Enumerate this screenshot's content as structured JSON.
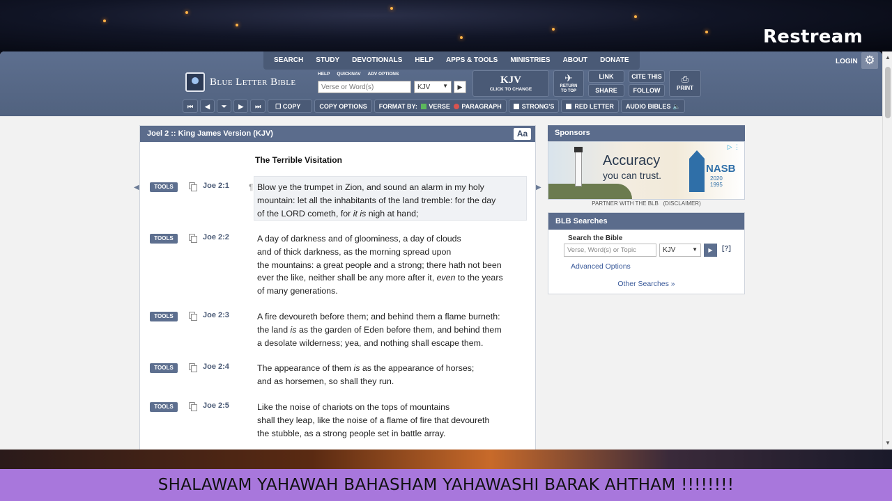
{
  "overlay": {
    "brand": "Restream",
    "banner_text": "SHALAWAM YAHAWAH BAHASHAM YAHAWASHI BARAK AHTHAM !!!!!!!!"
  },
  "header": {
    "nav": [
      "SEARCH",
      "STUDY",
      "DEVOTIONALS",
      "HELP",
      "APPS & TOOLS",
      "MINISTRIES",
      "ABOUT",
      "DONATE"
    ],
    "login": "LOGIN",
    "logo": "Blue Letter Bible",
    "mini_links": [
      "HELP",
      "QUICKNAV",
      "ADV OPTIONS"
    ],
    "search_placeholder": "Verse or Word(s)",
    "version": "KJV",
    "kjv_big": "KJV",
    "kjv_small": "CLICK TO CHANGE",
    "return_top": [
      "RETURN",
      "TO TOP"
    ],
    "link": "LINK",
    "share": "SHARE",
    "cite": "CITE THIS",
    "follow": "FOLLOW",
    "print": "PRINT"
  },
  "toolbar": {
    "copy": "COPY",
    "copy_options": "COPY OPTIONS",
    "format_by": "FORMAT BY:",
    "verse": "VERSE",
    "paragraph": "PARAGRAPH",
    "strongs": "STRONG'S",
    "red_letter": "RED LETTER",
    "audio": "AUDIO BIBLES"
  },
  "main": {
    "title": "Joel 2 :: King James Version (KJV)",
    "aa": "Aa",
    "section_title": "The Terrible Visitation",
    "tools_label": "TOOLS",
    "verses": [
      {
        "ref": "Joe 2:1"
      },
      {
        "ref": "Joe 2:2"
      },
      {
        "ref": "Joe 2:3"
      },
      {
        "ref": "Joe 2:4"
      },
      {
        "ref": "Joe 2:5"
      }
    ],
    "v1": {
      "l1": "Blow ye the trumpet in Zion, and sound an alarm in my holy",
      "l2": "mountain: let all the inhabitants of the land tremble: for the day",
      "l3a": "of the LORD cometh, for ",
      "l3i": "it is",
      "l3b": " nigh at hand;"
    },
    "v2": {
      "l1": "A day of darkness and of gloominess, a day of clouds",
      "l2": "and of thick darkness, as the morning spread upon",
      "l3": "the mountains: a great people and a strong; there hath not been",
      "l4a": "ever the like, neither shall be any more after it, ",
      "l4i": "even",
      "l4b": " to the years",
      "l5": "of many generations."
    },
    "v3": {
      "l1": "A fire devoureth before them; and behind them a flame burneth:",
      "l2a": "the land ",
      "l2i": "is",
      "l2b": " as the garden of Eden before them, and behind them",
      "l3": "a desolate wilderness; yea, and nothing shall escape them."
    },
    "v4": {
      "l1a": "The appearance of them ",
      "l1i": "is",
      "l1b": " as the appearance of horses;",
      "l2": "and as horsemen, so shall they run."
    },
    "v5": {
      "l1": "Like the noise of chariots on the tops of mountains",
      "l2": "shall they leap, like the noise of a flame of fire that devoureth",
      "l3": "the stubble, as a strong people set in battle array."
    }
  },
  "sidebar": {
    "sponsors_title": "Sponsors",
    "ad_headline": "Accuracy",
    "ad_sub": "you can trust.",
    "ad_brand": "NASB",
    "ad_years": [
      "2020",
      "1995"
    ],
    "partner": "PARTNER WITH THE BLB",
    "disclaimer": "(DISCLAIMER)",
    "searches_title": "BLB Searches",
    "search_label": "Search the Bible",
    "search_placeholder": "Verse, Word(s) or Topic",
    "version": "KJV",
    "help": "[?]",
    "advanced": "Advanced Options",
    "other": "Other Searches »"
  }
}
